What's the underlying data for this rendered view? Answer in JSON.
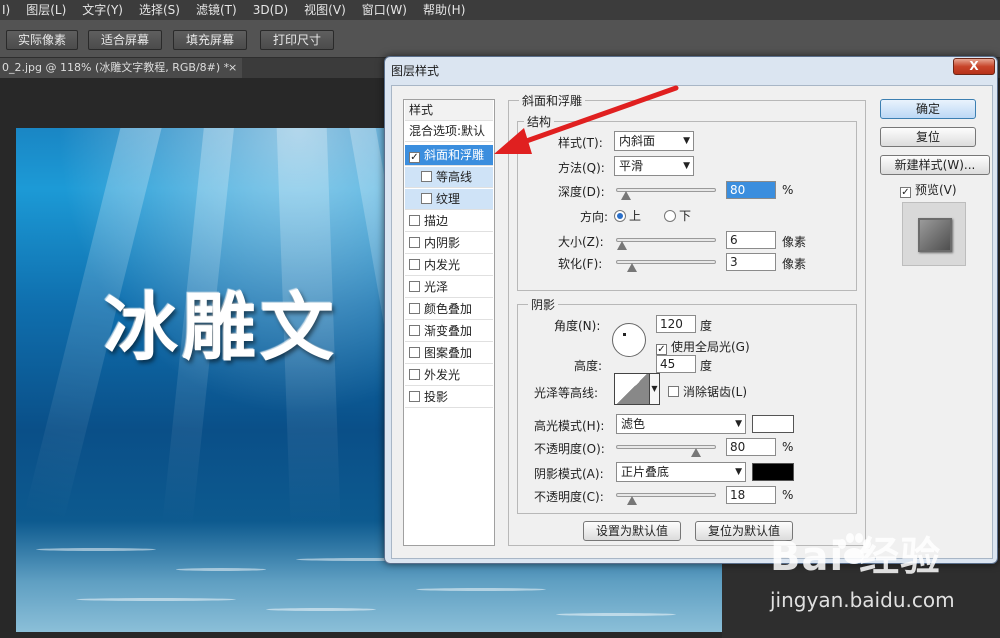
{
  "menubar": {
    "items": [
      "I)",
      "图层(L)",
      "文字(Y)",
      "选择(S)",
      "滤镜(T)",
      "3D(D)",
      "视图(V)",
      "窗口(W)",
      "帮助(H)"
    ]
  },
  "optbar": {
    "buttons": [
      "实际像素",
      "适合屏幕",
      "填充屏幕",
      "打印尺寸"
    ]
  },
  "document_tab": {
    "title": "0_2.jpg @ 118% (冰雕文字教程, RGB/8#) *",
    "close": "×"
  },
  "canvas": {
    "text": "冰雕文"
  },
  "dialog": {
    "title": "图层样式",
    "close": "X",
    "style_list": {
      "header": "样式",
      "blend": "混合选项:默认",
      "items": [
        {
          "label": "斜面和浮雕",
          "checked": true,
          "selected": true
        },
        {
          "label": "等高线",
          "checked": false,
          "sub": true
        },
        {
          "label": "纹理",
          "checked": false,
          "sub": true
        },
        {
          "label": "描边",
          "checked": false
        },
        {
          "label": "内阴影",
          "checked": false
        },
        {
          "label": "内发光",
          "checked": false
        },
        {
          "label": "光泽",
          "checked": false
        },
        {
          "label": "颜色叠加",
          "checked": false
        },
        {
          "label": "渐变叠加",
          "checked": false
        },
        {
          "label": "图案叠加",
          "checked": false
        },
        {
          "label": "外发光",
          "checked": false
        },
        {
          "label": "投影",
          "checked": false
        }
      ]
    },
    "bevel": {
      "group_title": "斜面和浮雕",
      "structure_title": "结构",
      "style_label": "样式(T):",
      "style_value": "内斜面",
      "technique_label": "方法(Q):",
      "technique_value": "平滑",
      "depth_label": "深度(D):",
      "depth_value": "80",
      "depth_unit": "%",
      "direction_label": "方向:",
      "direction_up": "上",
      "direction_down": "下",
      "size_label": "大小(Z):",
      "size_value": "6",
      "size_unit": "像素",
      "soften_label": "软化(F):",
      "soften_value": "3",
      "soften_unit": "像素"
    },
    "shading": {
      "group_title": "阴影",
      "angle_label": "角度(N):",
      "angle_value": "120",
      "angle_unit": "度",
      "global_light_label": "使用全局光(G)",
      "altitude_label": "高度:",
      "altitude_value": "45",
      "altitude_unit": "度",
      "gloss_label": "光泽等高线:",
      "anti_alias_label": "消除锯齿(L)",
      "highlight_mode_label": "高光模式(H):",
      "highlight_mode_value": "滤色",
      "highlight_color": "#ffffff",
      "highlight_opacity_label": "不透明度(O):",
      "highlight_opacity_value": "80",
      "highlight_opacity_unit": "%",
      "shadow_mode_label": "阴影模式(A):",
      "shadow_mode_value": "正片叠底",
      "shadow_color": "#000000",
      "shadow_opacity_label": "不透明度(C):",
      "shadow_opacity_value": "18",
      "shadow_opacity_unit": "%"
    },
    "bottom_buttons": {
      "make_default": "设置为默认值",
      "reset_default": "复位为默认值"
    },
    "right_buttons": {
      "ok": "确定",
      "reset": "复位",
      "new_style": "新建样式(W)...",
      "preview_label": "预览(V)"
    }
  },
  "watermark": {
    "logo": "Bai 经验",
    "url": "jingyan.baidu.com"
  }
}
